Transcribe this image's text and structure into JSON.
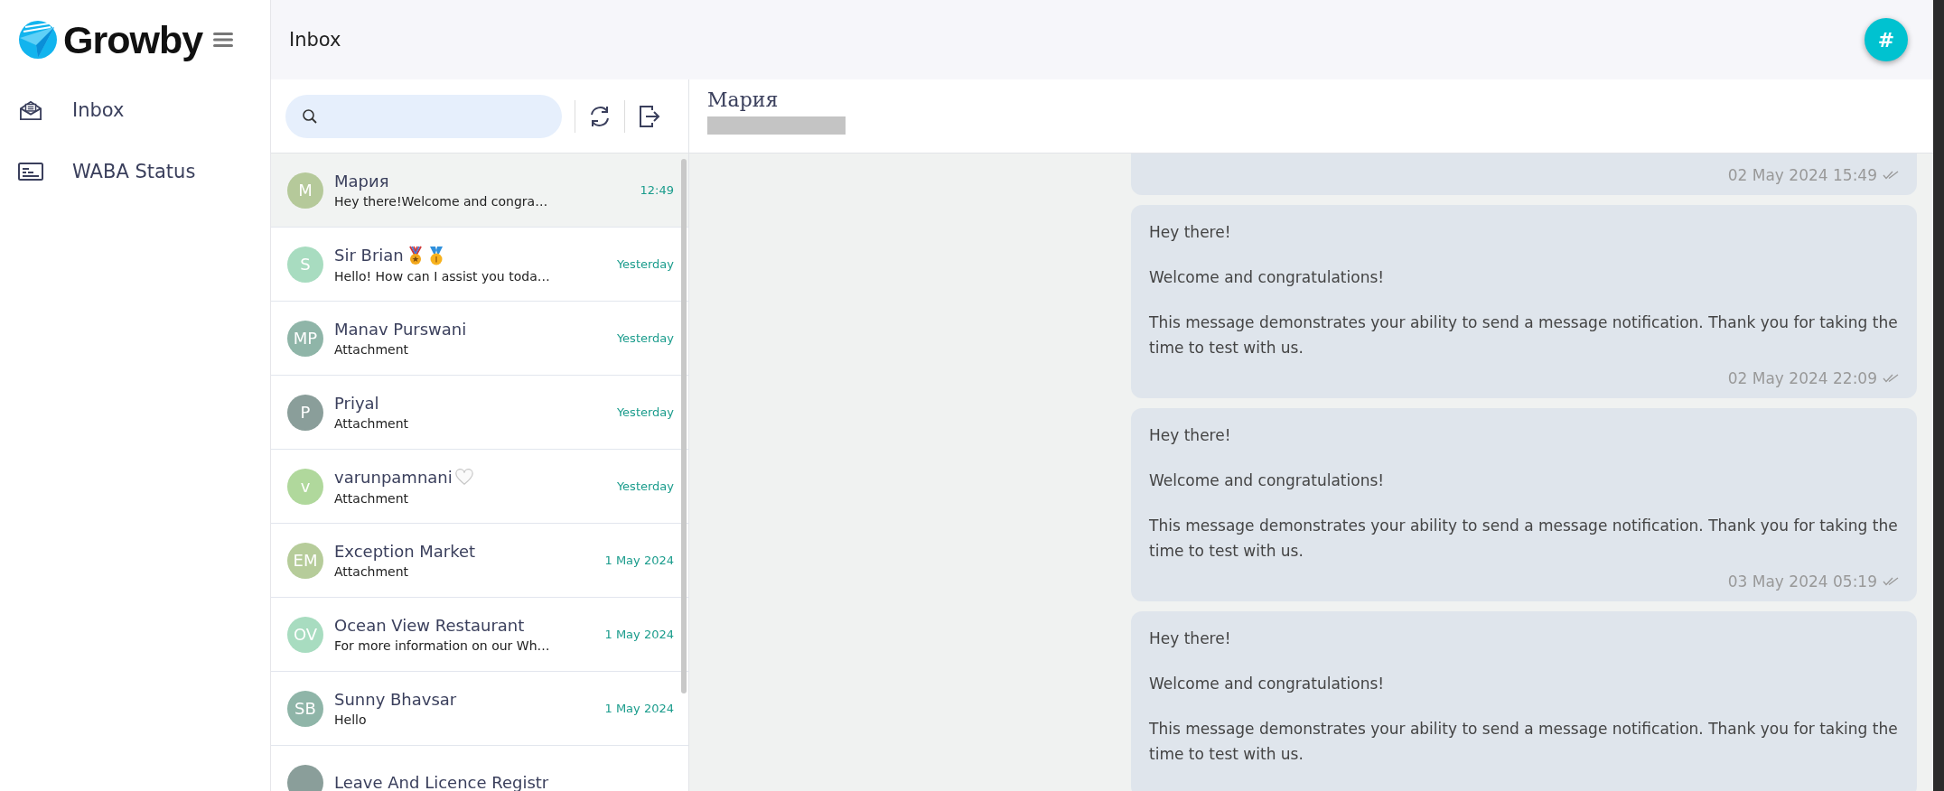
{
  "sidebar": {
    "brand": "Growby",
    "items": [
      {
        "label": "Inbox",
        "kind": "inbox",
        "selected": false
      },
      {
        "label": "WABA Status",
        "kind": "status",
        "selected": false
      }
    ]
  },
  "header": {
    "title": "Inbox",
    "avatar": "#"
  },
  "conversations": [
    {
      "initials": "M",
      "name": "Мария",
      "preview": "Hey there!Welcome and congra…",
      "time": "12:49",
      "color": "#b5c99a",
      "selected": true
    },
    {
      "initials": "S",
      "name": "Sir Brian",
      "badges": [
        {
          "kind": "ribbon-medal"
        },
        {
          "kind": "first-medal"
        }
      ],
      "preview": "Hello! How can I assist you toda…",
      "time": "Yesterday",
      "color": "#a8dcc0",
      "selected": false
    },
    {
      "initials": "MP",
      "name": "Manav Purswani",
      "preview": "Attachment",
      "time": "Yesterday",
      "color": "#8fb5a8",
      "selected": false
    },
    {
      "initials": "P",
      "name": "Priyal",
      "preview": "Attachment",
      "time": "Yesterday",
      "color": "#8a9e9a",
      "selected": false
    },
    {
      "initials": "v",
      "name": "varunpamnani",
      "badges": [
        {
          "kind": "heart"
        }
      ],
      "preview": "Attachment",
      "time": "Yesterday",
      "color": "#b0d89c",
      "selected": false
    },
    {
      "initials": "EM",
      "name": "Exception Market",
      "preview": "Attachment",
      "time": "1 May 2024",
      "color": "#b6cc9a",
      "selected": false
    },
    {
      "initials": "OV",
      "name": "Ocean View Restaurant",
      "preview": "For more information on our Wh…",
      "time": "1 May 2024",
      "color": "#a8dcc0",
      "selected": false
    },
    {
      "initials": "SB",
      "name": "Sunny Bhavsar",
      "preview": "Hello",
      "time": "1 May 2024",
      "color": "#8fb5a8",
      "selected": false
    },
    {
      "name": "Leave And Licence Registr",
      "color": "#8a9e9a",
      "selected": false
    }
  ],
  "chat": {
    "contact": "Мария",
    "messages": [
      {
        "time": "02 May 2024 15:49"
      },
      {
        "paragraphs": [
          "Hey there!",
          "Welcome and congratulations!",
          "This message demonstrates your ability to send a message notification. Thank you for taking the time to test with us."
        ],
        "time": "02 May 2024 22:09"
      },
      {
        "paragraphs": [
          "Hey there!",
          "Welcome and congratulations!",
          "This message demonstrates your ability to send a message notification. Thank you for taking the time to test with us."
        ],
        "time": "03 May 2024 05:19"
      },
      {
        "paragraphs": [
          "Hey there!",
          "Welcome and congratulations!",
          "This message demonstrates your ability to send a message notification. Thank you for taking the time to test with us."
        ]
      }
    ]
  }
}
